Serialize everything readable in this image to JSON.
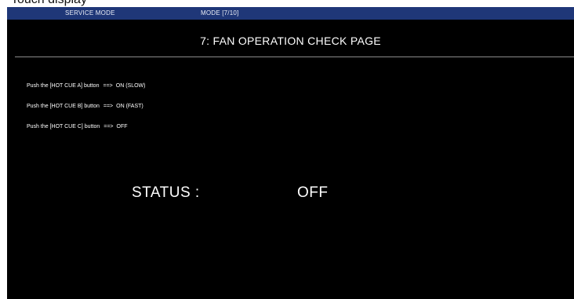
{
  "caption": "Touch display",
  "header": {
    "mode_label": "SERVICE MODE",
    "mode_indicator": "MODE [7/10]",
    "bar_color": "#1f3778"
  },
  "page": {
    "title": "7: FAN OPERATION CHECK PAGE"
  },
  "instructions": [
    {
      "text": "Push the [HOT CUE A] button",
      "arrow": "==>",
      "result": "ON (SLOW)"
    },
    {
      "text": "Push the [HOT CUE B] button",
      "arrow": "==>",
      "result": "ON (FAST)"
    },
    {
      "text": "Push the [HOT CUE C] button",
      "arrow": "==>",
      "result": "OFF"
    }
  ],
  "status": {
    "label": "STATUS :",
    "value": "OFF"
  }
}
